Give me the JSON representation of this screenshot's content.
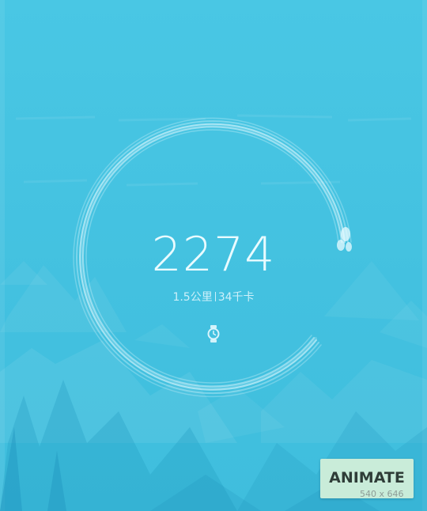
{
  "steps": {
    "count": "2274",
    "distance": "1.5公里",
    "calories": "34千卡"
  },
  "progress": {
    "fraction": 0.92
  },
  "icons": {
    "device": "watch-icon"
  },
  "action": {
    "label": "ANIMATE"
  },
  "overlay": {
    "dimensions": "540 x 646"
  },
  "colors": {
    "background": "#45c3e2",
    "ring": "#e8fbff",
    "button": "#c9ecd9"
  }
}
